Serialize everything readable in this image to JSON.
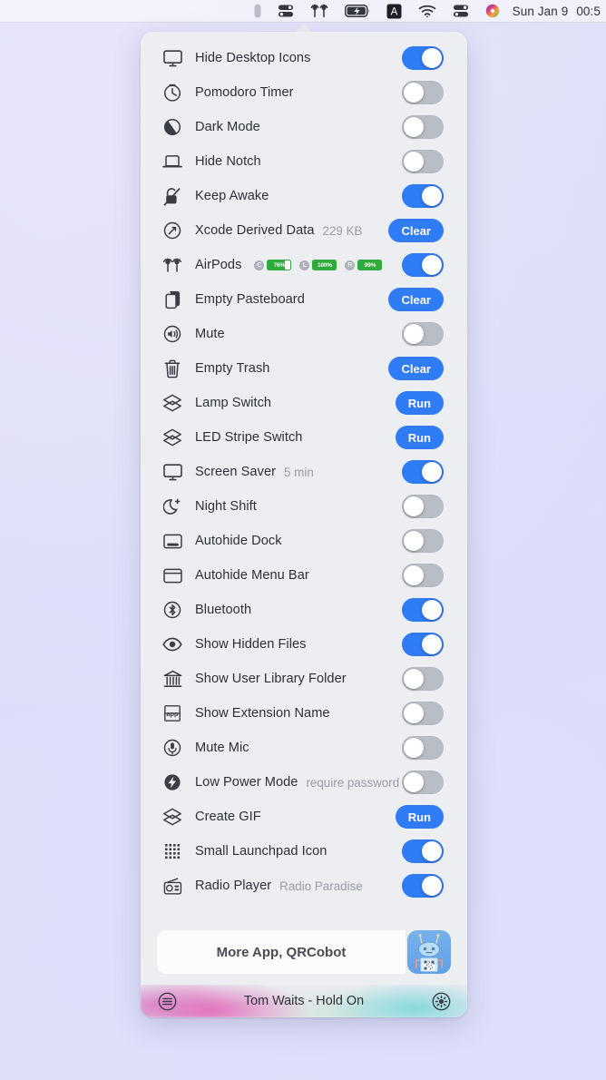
{
  "menubar": {
    "icons": [
      {
        "name": "pill-capsule-icon"
      },
      {
        "name": "toggles-icon"
      },
      {
        "name": "airpods-icon"
      },
      {
        "name": "battery-charging-icon"
      },
      {
        "name": "input-source-A-icon"
      },
      {
        "name": "wifi-icon"
      },
      {
        "name": "control-center-icon"
      },
      {
        "name": "color-wheel-icon"
      }
    ],
    "clock_date": "Sun Jan 9",
    "clock_time": "00:5"
  },
  "panel": {
    "rows": [
      {
        "icon": "display-icon",
        "label": "Hide Desktop Icons",
        "sub": "",
        "control": "toggle",
        "state": "on"
      },
      {
        "icon": "timer-icon",
        "label": "Pomodoro Timer",
        "sub": "",
        "control": "toggle",
        "state": "off"
      },
      {
        "icon": "dark-mode-icon",
        "label": "Dark Mode",
        "sub": "",
        "control": "toggle",
        "state": "off"
      },
      {
        "icon": "laptop-notch-icon",
        "label": "Hide Notch",
        "sub": "",
        "control": "toggle",
        "state": "off"
      },
      {
        "icon": "keep-awake-icon",
        "label": "Keep Awake",
        "sub": "",
        "control": "toggle",
        "state": "on"
      },
      {
        "icon": "xcode-hammer-icon",
        "label": "Xcode Derived Data",
        "sub": "229 KB",
        "control": "button",
        "button_label": "Clear"
      },
      {
        "icon": "airpods-icon",
        "label": "AirPods",
        "sub": "",
        "control": "toggle",
        "state": "on",
        "batteries": [
          {
            "letter": "C",
            "percent": "76%",
            "value": 76
          },
          {
            "letter": "L",
            "percent": "100%",
            "value": 100
          },
          {
            "letter": "R",
            "percent": "99%",
            "value": 99
          }
        ]
      },
      {
        "icon": "pasteboard-icon",
        "label": "Empty Pasteboard",
        "sub": "",
        "control": "button",
        "button_label": "Clear"
      },
      {
        "icon": "speaker-icon",
        "label": "Mute",
        "sub": "",
        "control": "toggle",
        "state": "off"
      },
      {
        "icon": "trash-icon",
        "label": "Empty Trash",
        "sub": "",
        "control": "button",
        "button_label": "Clear"
      },
      {
        "icon": "layers-icon",
        "label": "Lamp Switch",
        "sub": "",
        "control": "button",
        "button_label": "Run"
      },
      {
        "icon": "layers-icon",
        "label": "LED Stripe Switch",
        "sub": "",
        "control": "button",
        "button_label": "Run"
      },
      {
        "icon": "display-icon",
        "label": "Screen Saver",
        "sub": "5 min",
        "control": "toggle",
        "state": "on"
      },
      {
        "icon": "night-shift-icon",
        "label": "Night Shift",
        "sub": "",
        "control": "toggle",
        "state": "off"
      },
      {
        "icon": "dock-icon",
        "label": "Autohide Dock",
        "sub": "",
        "control": "toggle",
        "state": "off"
      },
      {
        "icon": "menubar-icon",
        "label": "Autohide Menu Bar",
        "sub": "",
        "control": "toggle",
        "state": "off"
      },
      {
        "icon": "bluetooth-icon",
        "label": "Bluetooth",
        "sub": "",
        "control": "toggle",
        "state": "on"
      },
      {
        "icon": "eye-icon",
        "label": "Show Hidden Files",
        "sub": "",
        "control": "toggle",
        "state": "on"
      },
      {
        "icon": "library-icon",
        "label": "Show User Library Folder",
        "sub": "",
        "control": "toggle",
        "state": "off"
      },
      {
        "icon": "extension-name-icon",
        "label": "Show Extension Name",
        "sub": "",
        "control": "toggle",
        "state": "off"
      },
      {
        "icon": "microphone-icon",
        "label": "Mute Mic",
        "sub": "",
        "control": "toggle",
        "state": "off"
      },
      {
        "icon": "low-power-icon",
        "label": "Low Power Mode",
        "sub": "require password",
        "control": "toggle",
        "state": "off"
      },
      {
        "icon": "layers-icon",
        "label": "Create GIF",
        "sub": "",
        "control": "button",
        "button_label": "Run"
      },
      {
        "icon": "launchpad-grid-icon",
        "label": "Small Launchpad Icon",
        "sub": "",
        "control": "toggle",
        "state": "on"
      },
      {
        "icon": "radio-icon",
        "label": "Radio Player",
        "sub": "Radio Paradise",
        "control": "toggle",
        "state": "on"
      }
    ]
  },
  "footer": {
    "more_app_label": "More App, QRCobot",
    "app_icon_name": "qrcobot-app-icon",
    "nowplaying": {
      "left_icon": "playlist-icon",
      "title": "Tom Waits - Hold On",
      "right_icon": "settings-gear-icon"
    }
  },
  "colors": {
    "accent_blue": "#2f7cf6",
    "toggle_off": "#b9bdc5",
    "panel_bg": "#eceef2",
    "battery_green": "#2faa3d",
    "desktop_bg": "#dfe0f7"
  }
}
